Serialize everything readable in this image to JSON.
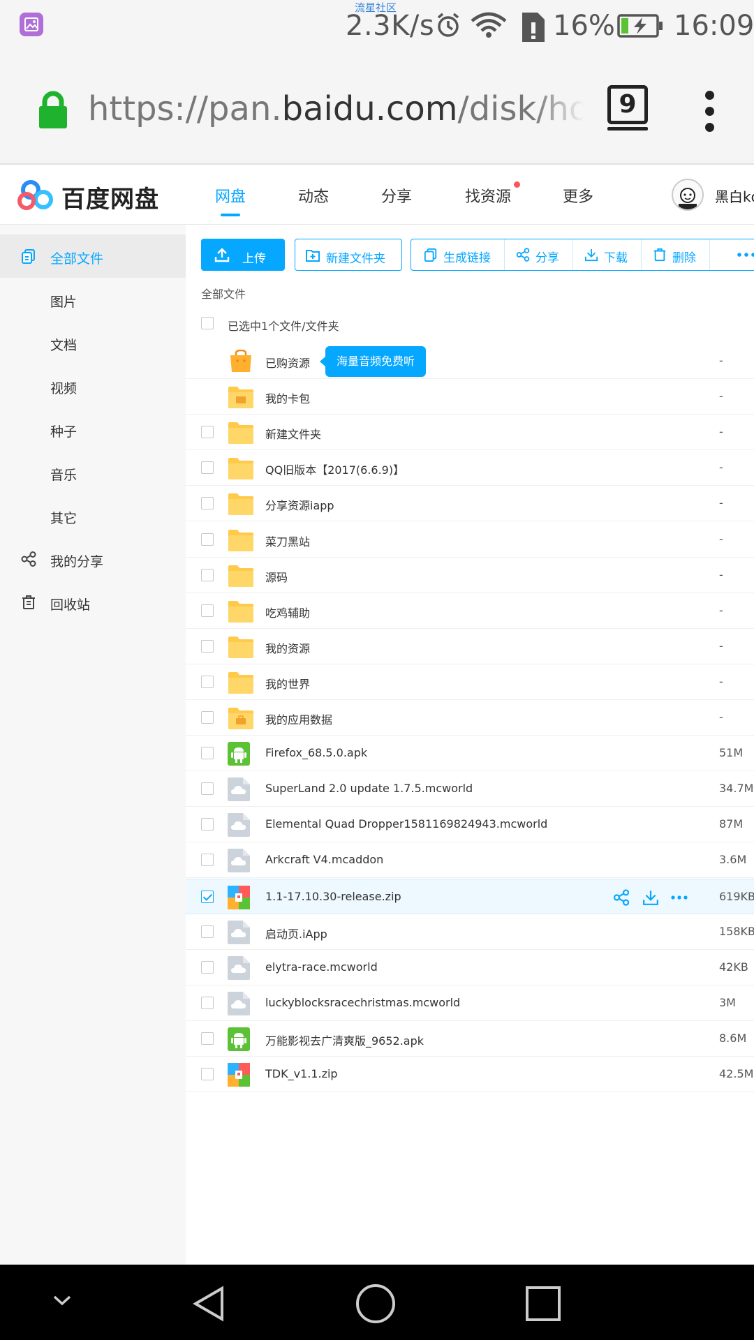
{
  "status_bar": {
    "carrier": "流星社区",
    "speed": "2.3K/s",
    "battery_percent": "16%",
    "time": "16:09"
  },
  "browser": {
    "url_scheme": "https://pan.",
    "url_host": "baidu.com",
    "url_path": "/disk/home",
    "tab_count": "9"
  },
  "header": {
    "logo_text": "百度网盘",
    "nav": [
      {
        "label": "网盘",
        "active": true
      },
      {
        "label": "动态"
      },
      {
        "label": "分享"
      },
      {
        "label": "找资源",
        "has_dot": true
      },
      {
        "label": "更多"
      }
    ],
    "username": "黑白kc"
  },
  "sidebar": {
    "items": [
      {
        "label": "全部文件",
        "active": true,
        "icon": "files-icon"
      },
      {
        "label": "图片"
      },
      {
        "label": "文档"
      },
      {
        "label": "视频"
      },
      {
        "label": "种子"
      },
      {
        "label": "音乐"
      },
      {
        "label": "其它"
      },
      {
        "label": "我的分享",
        "icon": "share-icon"
      },
      {
        "label": "回收站",
        "icon": "trash-icon"
      }
    ]
  },
  "toolbar": {
    "upload": "上传",
    "new_folder": "新建文件夹",
    "gen_link": "生成链接",
    "share": "分享",
    "download": "下载",
    "delete": "删除"
  },
  "breadcrumb": "全部文件",
  "selection_text": "已选中1个文件/文件夹",
  "tooltip": "海量音频免费听",
  "files": [
    {
      "name": "已购资源",
      "size": "-",
      "type": "purchased",
      "checkbox": false
    },
    {
      "name": "我的卡包",
      "size": "-",
      "type": "card-folder",
      "checkbox": false
    },
    {
      "name": "新建文件夹",
      "size": "-",
      "type": "folder"
    },
    {
      "name": "QQ旧版本【2017(6.6.9)】",
      "size": "-",
      "type": "folder"
    },
    {
      "name": "分享资源iapp",
      "size": "-",
      "type": "folder"
    },
    {
      "name": "菜刀黑站",
      "size": "-",
      "type": "folder"
    },
    {
      "name": "源码",
      "size": "-",
      "type": "folder"
    },
    {
      "name": "吃鸡辅助",
      "size": "-",
      "type": "folder"
    },
    {
      "name": "我的资源",
      "size": "-",
      "type": "folder"
    },
    {
      "name": "我的世界",
      "size": "-",
      "type": "folder"
    },
    {
      "name": "我的应用数据",
      "size": "-",
      "type": "app-folder"
    },
    {
      "name": "Firefox_68.5.0.apk",
      "size": "51M",
      "type": "apk"
    },
    {
      "name": "SuperLand 2.0 update 1.7.5.mcworld",
      "size": "34.7M",
      "type": "cloud"
    },
    {
      "name": "Elemental Quad Dropper1581169824943.mcworld",
      "size": "87M",
      "type": "cloud"
    },
    {
      "name": "Arkcraft V4.mcaddon",
      "size": "3.6M",
      "type": "cloud"
    },
    {
      "name": "1.1-17.10.30-release.zip",
      "size": "619KB",
      "type": "zip",
      "selected": true
    },
    {
      "name": "启动页.iApp",
      "size": "158KB",
      "type": "cloud"
    },
    {
      "name": "elytra-race.mcworld",
      "size": "42KB",
      "type": "cloud"
    },
    {
      "name": "luckyblocksracechristmas.mcworld",
      "size": "3M",
      "type": "cloud"
    },
    {
      "name": "万能影视去广清爽版_9652.apk",
      "size": "8.6M",
      "type": "apk"
    },
    {
      "name": "TDK_v1.1.zip",
      "size": "42.5M",
      "type": "zip"
    }
  ],
  "colors": {
    "accent": "#06a7ff",
    "folder": "#ffc94a",
    "apk": "#5bc236",
    "lock": "#1fb22e"
  }
}
